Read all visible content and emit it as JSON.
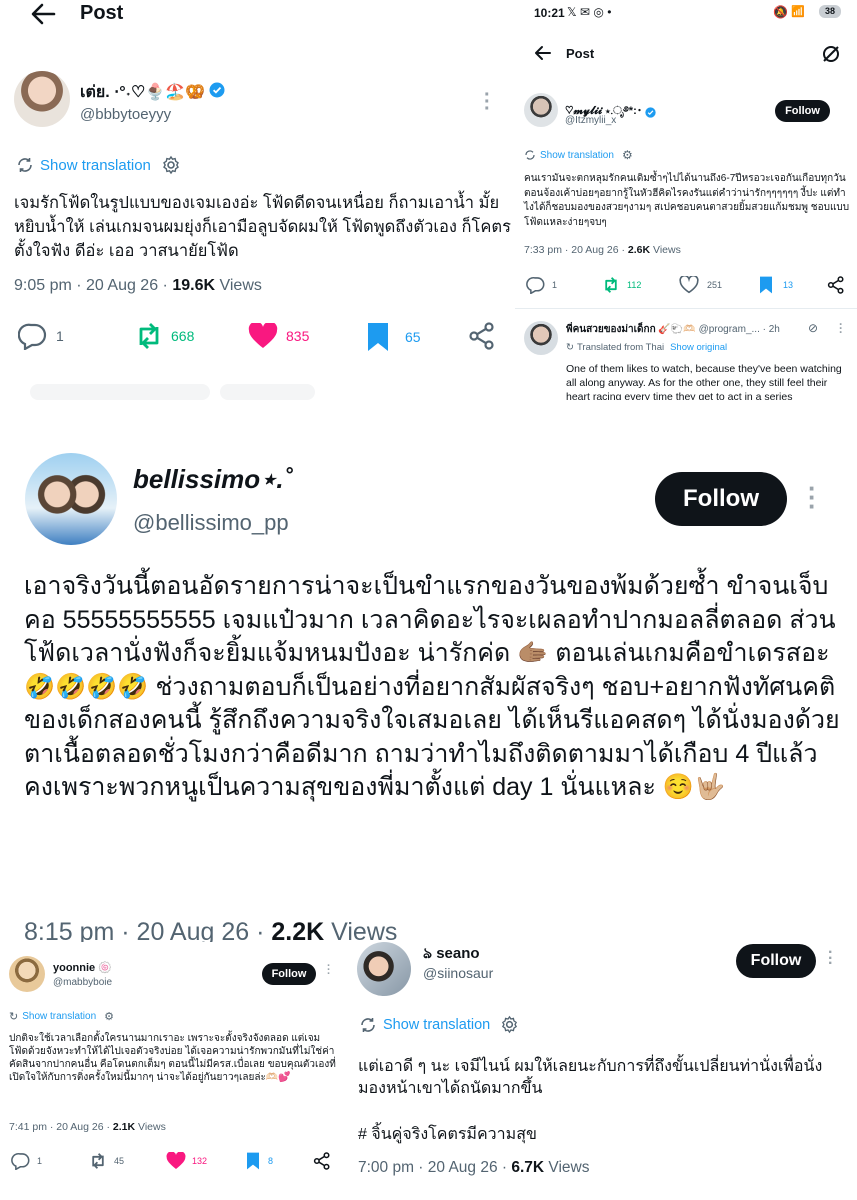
{
  "p1": {
    "header_title": "Post",
    "display_name": "เต่ย. ⋅°˖♡🍨🏖️🥨",
    "handle": "@bbbytoeyyy",
    "show_translation": "Show translation",
    "text": "เจมรักโฟ้ดในรูปแบบของเจมเองอ่ะ โฟ้ดดีดจนเหนื่อย ก็ถามเอาน้ำ มั้ยหยิบน้ำให้ เล่นเกมจนผมยุ่งก็เอามือลูบจัดผมให้ โฟ้ดพูดถึงตัวเอง ก็โคตรตั้งใจฟัง ดีอ่ะ เออ วาสนายัยโฟ้ด",
    "time": "9:05 pm · 20 Aug 26 · ",
    "views_count": "19.6K",
    "views_label": " Views",
    "replies": "1",
    "reposts": "668",
    "likes": "835",
    "bookmarks": "65",
    "colors": {
      "repost": "#00ba7c",
      "like": "#f91880",
      "bookmark": "#1d9bf0"
    }
  },
  "p2": {
    "status_time": "10:21",
    "status_icons": "𝕏 ✉ ◎ •",
    "battery": "38",
    "header_title": "Post",
    "display_name": "♡𝓶𝔂𝓵𝓲𝓲 ⋆.ೃ࿔*:･",
    "handle": "@Itzmylii_x",
    "follow": "Follow",
    "show_translation": "Show translation",
    "text": "คนเรามันจะตกหลุมรักคนเดิมซ้ำๆไปได้นานถึง6-7ปีหรอวะเจอกันเกือบทุกวันตอนจ้องเค้าบ่อยๆอยากรู้ในหัวฮีคิดไรคงรันแต่คำว่าน่ารักๆๆๆๆๆๆ งี้ปะ แต่ทำไงได้ก็ชอบมองของสวยๆงามๆ สเปคชอบคนตาสวยยิ้มสวยแก้มชมพู ชอบแบบโฟ้ดแหละง่ายๆจบๆ",
    "time": "7:33 pm · 20 Aug 26 · ",
    "views_count": "2.6K",
    "views_label": " Views",
    "replies": "1",
    "reposts": "112",
    "likes": "251",
    "bookmarks": "13",
    "reply_name": "พี่คนสวยของม่าเด็กก 🎸🐑🫶🏻",
    "reply_handle": "@program_...",
    "reply_time": "· 2h",
    "translated_from": "Translated from Thai",
    "show_original": "Show original",
    "reply_text": "One of them likes to watch, because they've been watching all along anyway. As for the other one, they still feel their heart racing every time they get to act in a series"
  },
  "p3": {
    "display_name": "bellissimo⋆.˚",
    "handle": "@bellissimo_pp",
    "follow": "Follow",
    "text": "เอาจริงวันนี้ตอนอัดรายการน่าจะเป็นขำแรกของวันของพ้มด้วยซ้ำ ขำจนเจ็บคอ 55555555555 เจมแป๋วมาก เวลาคิดอะไรจะเผลอทำปากมอลลี่ตลอด ส่วนโฟ้ดเวลานั่งฟังก็จะยิ้มแจ้มหนมปังอะ น่ารักค่ด 🫱🏽 ตอนเล่นเกมคือขำเดรสอะ 🤣🤣🤣🤣 ช่วงถามตอบก็เป็นอย่างที่อยากสัมผัสจริงๆ ชอบ+อยากฟังทัศนคติของเด็กสองคนนี้ รู้สึกถึงความจริงใจเสมอเลย ได้เห็นรีแอคสดๆ ได้นั่งมองด้วยตาเนื้อตลอดชั่วโมงกว่าคือดีมาก ถามว่าทำไมถึงติดตามมาได้เกือบ 4 ปีแล้ว คงเพราะพวกหนูเป็นความสุขของพี่มาตั้งแต่ day 1 นั่นแหละ ☺️🤟🏼",
    "time": "8:15 pm · 20 Aug 26 · ",
    "views_count": "2.2K",
    "views_label": " Views"
  },
  "p4": {
    "display_name": "yoonnie 🍥",
    "handle": "@mabbyboie",
    "follow": "Follow",
    "show_translation": "Show translation",
    "text": "ปกติจะใช้เวลาเลือกตั้งใครนานมากเราอะ เพราะจะตั้งจริงจังตลอด แต่เจมโฟ้ดด้วยจังหวะทำให้ได้ไปเจอตัวจริงบ่อย ได้เจอความน่ารักพวกมันที่ไม่ใช่ค่าคัดสินจากปากคนอื่น คือโดนตกเต็มๆ ตอนนี้ไม่มีครส.เบื่อเลย ขอบคุณตัวเองที่เปิดใจให้กับการติ่งครั้งใหม่นี้มากๆ น่าจะได้อยู่กันยาวๆเลยล่ะ🫶🏻💕",
    "time": "7:41 pm · 20 Aug 26 · ",
    "views_count": "2.1K",
    "views_label": " Views",
    "replies": "1",
    "reposts": "45",
    "likes": "132",
    "bookmarks": "8"
  },
  "p5": {
    "display_name": "ঌ seano",
    "handle": "@siinosaur",
    "follow": "Follow",
    "show_translation": "Show translation",
    "text": "แต่เอาดี ๆ นะ เจมีไนน์ ผมให้เลยนะกับการที่ถึงขั้นเปลี่ยนท่านั่งเพื่อนั่งมองหน้าเขาได้ถนัดมากขึ้น",
    "hashtag": "# จิ้นคู่จริงโคตรมีความสุข",
    "time": "7:00 pm · 20 Aug 26 · ",
    "views_count": "6.7K",
    "views_label": " Views"
  }
}
